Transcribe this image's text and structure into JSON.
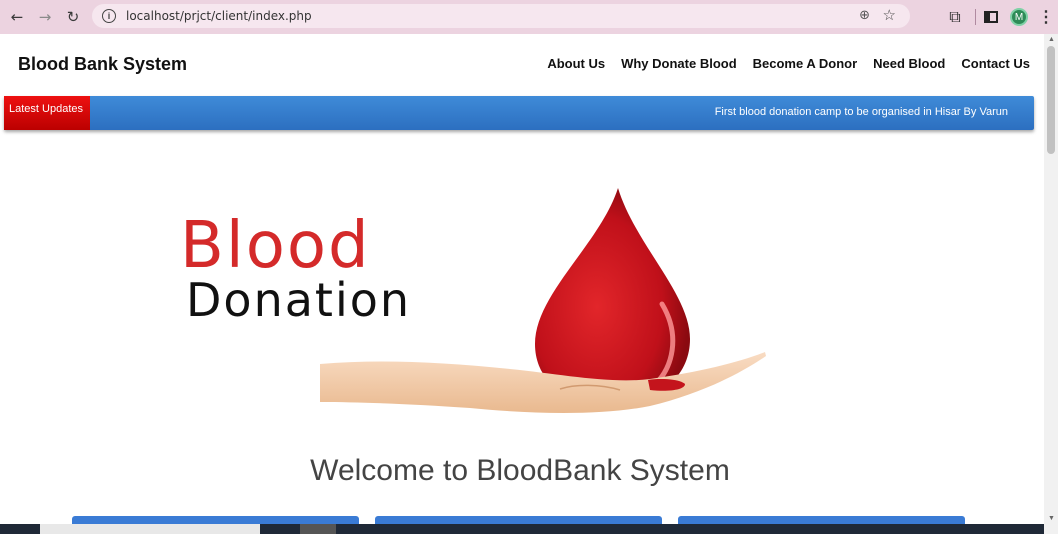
{
  "browser": {
    "url": "localhost/prjct/client/index.php",
    "profile_initial": "M"
  },
  "site": {
    "brand": "Blood Bank System",
    "nav": [
      "About Us",
      "Why Donate Blood",
      "Become A Donor",
      "Need Blood",
      "Contact Us"
    ]
  },
  "ticker": {
    "label": "Latest Updates",
    "text": "First blood donation camp to be organised in Hisar By Varun"
  },
  "hero": {
    "logo_word_1": "Blood",
    "logo_word_2": "Donation",
    "welcome": "Welcome to BloodBank System"
  },
  "icons": {
    "back": "arrow-left-icon",
    "forward": "arrow-right-icon",
    "reload": "reload-icon",
    "site_info": "info-icon",
    "zoom": "zoom-icon",
    "bookmark": "star-icon",
    "extensions": "puzzle-icon",
    "side_panel": "side-panel-icon",
    "menu": "more-vert-icon"
  },
  "colors": {
    "chrome_bg": "#ecd3e0",
    "ticker_bg": "#2c6fc0",
    "ticker_label_bg": "#cc0000",
    "logo_red": "#d42a2a",
    "card_blue": "#3a7bd5"
  }
}
